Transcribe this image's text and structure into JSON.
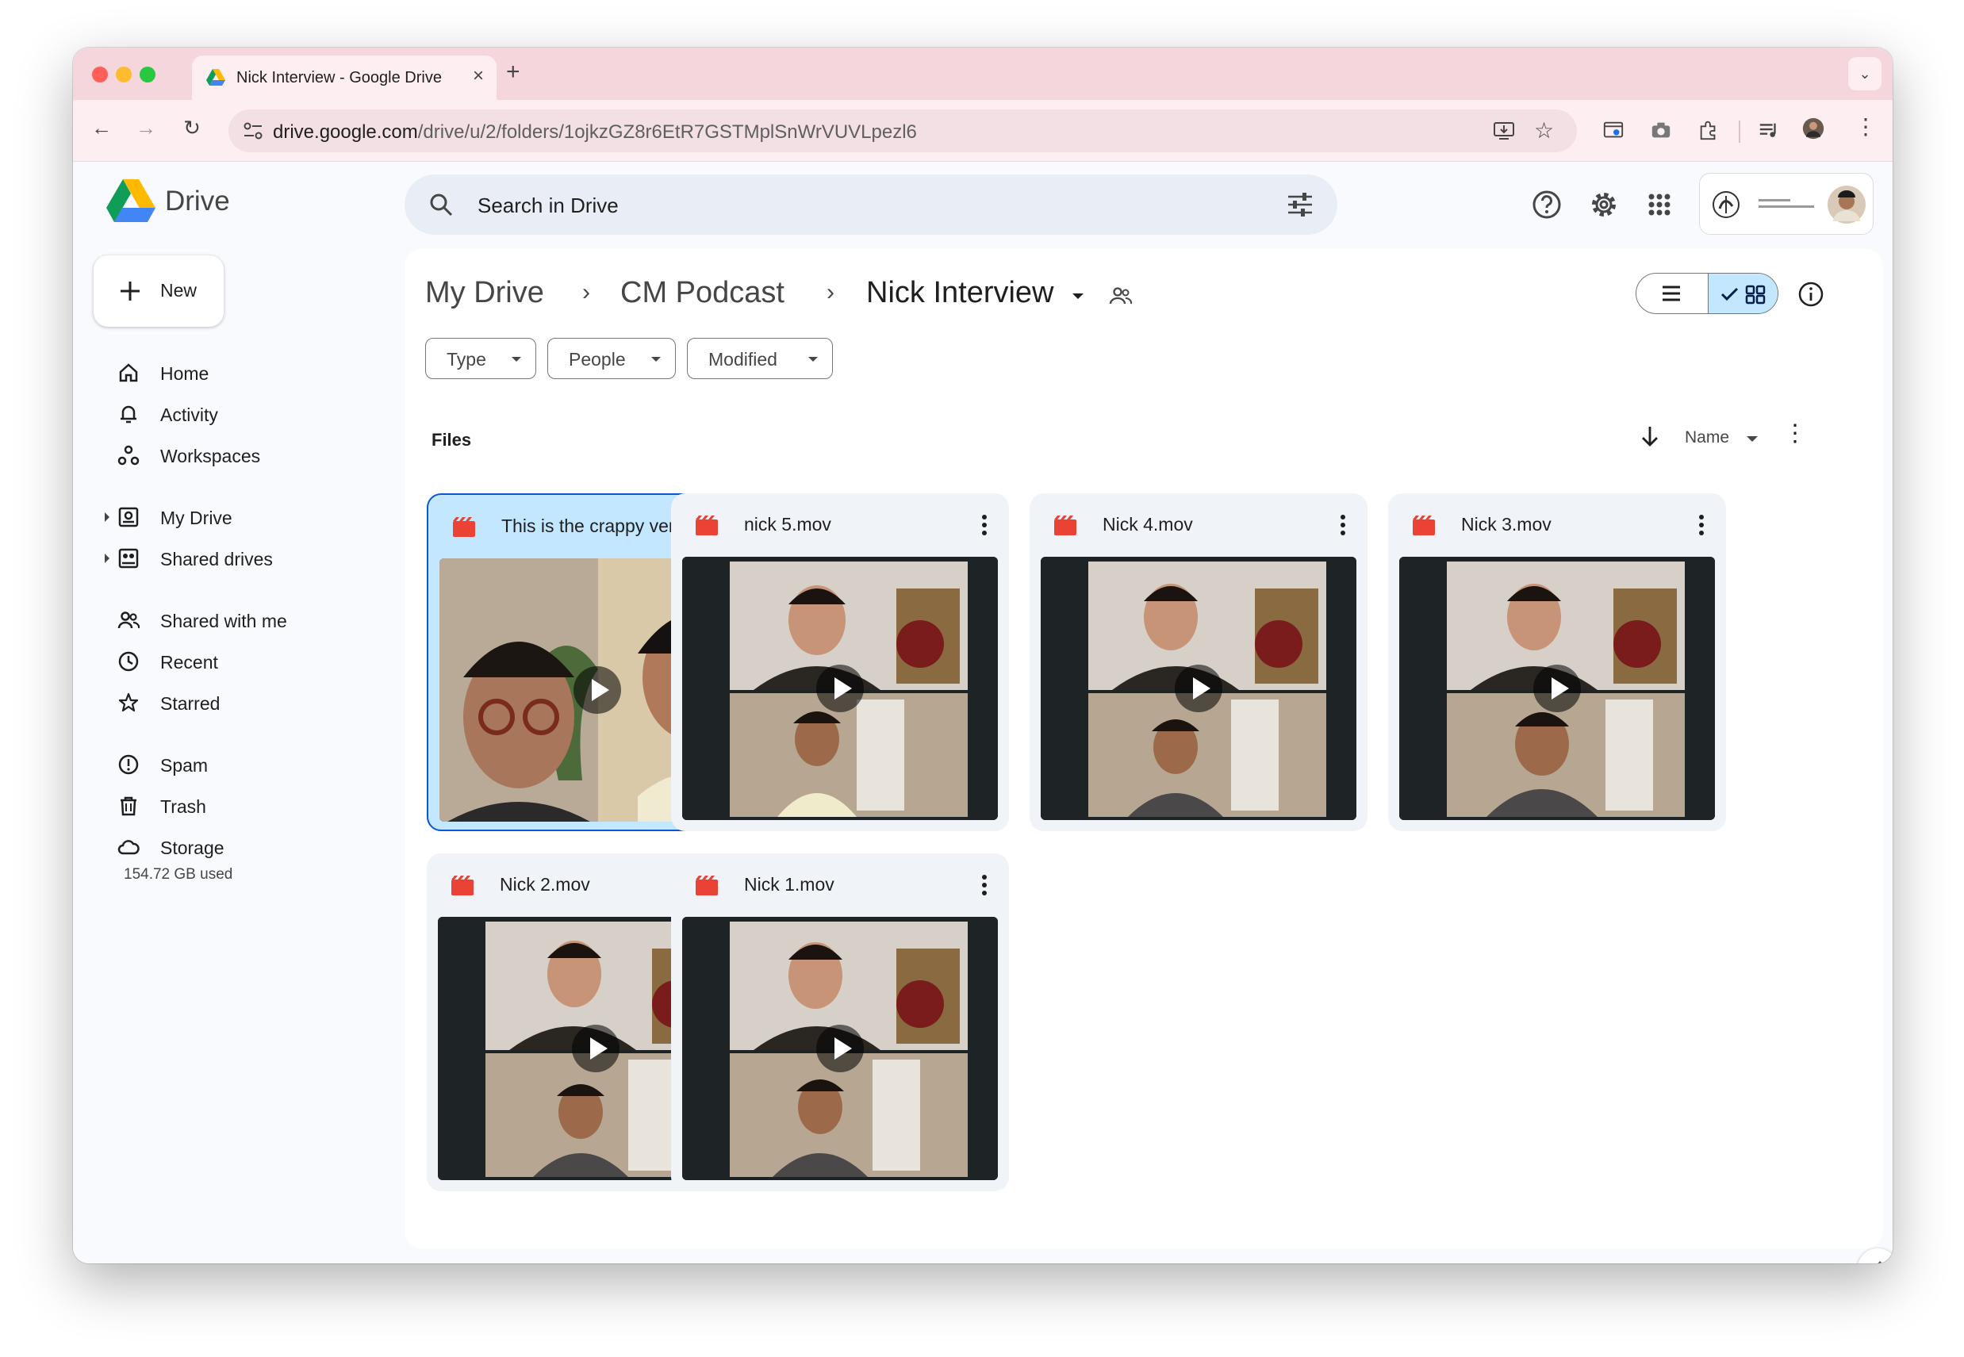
{
  "browser": {
    "tab_title": "Nick Interview - Google Drive",
    "url_host": "drive.google.com",
    "url_path": "/drive/u/2/folders/1ojkzGZ8r6EtR7GSTMplSnWrVUVLpezl6"
  },
  "app": {
    "name": "Drive",
    "search_placeholder": "Search in Drive"
  },
  "sidebar": {
    "new_label": "New",
    "items": [
      {
        "label": "Home",
        "icon": "home-icon"
      },
      {
        "label": "Activity",
        "icon": "bell-icon"
      },
      {
        "label": "Workspaces",
        "icon": "workspaces-icon"
      },
      {
        "label": "My Drive",
        "icon": "my-drive-icon"
      },
      {
        "label": "Shared drives",
        "icon": "shared-drives-icon"
      },
      {
        "label": "Shared with me",
        "icon": "people-icon"
      },
      {
        "label": "Recent",
        "icon": "clock-icon"
      },
      {
        "label": "Starred",
        "icon": "star-icon"
      },
      {
        "label": "Spam",
        "icon": "spam-icon"
      },
      {
        "label": "Trash",
        "icon": "trash-icon"
      },
      {
        "label": "Storage",
        "icon": "cloud-icon"
      }
    ],
    "storage_used": "154.72 GB used"
  },
  "breadcrumb": [
    "My Drive",
    "CM Podcast",
    "Nick Interview"
  ],
  "filters": [
    "Type",
    "People",
    "Modified"
  ],
  "files_section": {
    "title": "Files",
    "sort_label": "Name"
  },
  "files": [
    {
      "name": "This is the crappy ver...",
      "selected": true
    },
    {
      "name": "nick 5.mov",
      "selected": false
    },
    {
      "name": "Nick 4.mov",
      "selected": false
    },
    {
      "name": "Nick 3.mov",
      "selected": false
    },
    {
      "name": "Nick 2.mov",
      "selected": false
    },
    {
      "name": "Nick 1.mov",
      "selected": false
    }
  ],
  "colors": {
    "accent": "#0b57d0",
    "selected_bg": "#c2e7ff",
    "video_icon": "#ea4335",
    "tab_bar": "#f6d6dd"
  }
}
